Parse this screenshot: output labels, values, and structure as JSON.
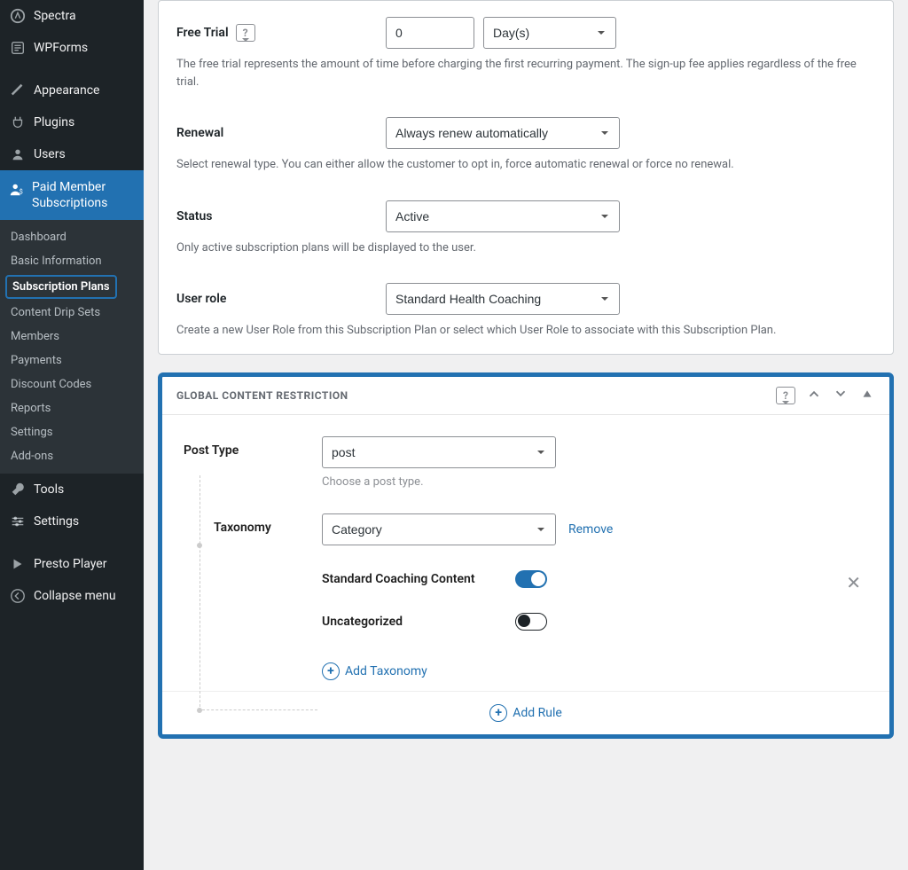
{
  "sidebar": {
    "items": [
      {
        "label": "Spectra",
        "icon": "spectra"
      },
      {
        "label": "WPForms",
        "icon": "wpforms"
      },
      {
        "label": "Appearance",
        "icon": "brush"
      },
      {
        "label": "Plugins",
        "icon": "plug"
      },
      {
        "label": "Users",
        "icon": "user"
      },
      {
        "label": "Paid Member Subscriptions",
        "icon": "pms",
        "active": true
      },
      {
        "label": "Tools",
        "icon": "wrench"
      },
      {
        "label": "Settings",
        "icon": "sliders"
      },
      {
        "label": "Presto Player",
        "icon": "presto"
      },
      {
        "label": "Collapse menu",
        "icon": "collapse"
      }
    ],
    "submenu": [
      "Dashboard",
      "Basic Information",
      "Subscription Plans",
      "Content Drip Sets",
      "Members",
      "Payments",
      "Discount Codes",
      "Reports",
      "Settings",
      "Add-ons"
    ],
    "active_submenu": "Subscription Plans"
  },
  "form": {
    "free_trial": {
      "label": "Free Trial",
      "value": "0",
      "unit": "Day(s)",
      "helper": "The free trial represents the amount of time before charging the first recurring payment. The sign-up fee applies regardless of the free trial."
    },
    "renewal": {
      "label": "Renewal",
      "value": "Always renew automatically",
      "helper": "Select renewal type. You can either allow the customer to opt in, force automatic renewal or force no renewal."
    },
    "status": {
      "label": "Status",
      "value": "Active",
      "helper": "Only active subscription plans will be displayed to the user."
    },
    "user_role": {
      "label": "User role",
      "value": "Standard Health Coaching",
      "helper": "Create a new User Role from this Subscription Plan or select which User Role to associate with this Subscription Plan."
    }
  },
  "gcr": {
    "title": "GLOBAL CONTENT RESTRICTION",
    "post_type": {
      "label": "Post Type",
      "value": "post",
      "helper": "Choose a post type."
    },
    "taxonomy": {
      "label": "Taxonomy",
      "value": "Category",
      "remove": "Remove",
      "terms": [
        {
          "label": "Standard Coaching Content",
          "on": true
        },
        {
          "label": "Uncategorized",
          "on": false
        }
      ]
    },
    "add_taxonomy": "Add Taxonomy",
    "add_rule": "Add Rule"
  }
}
